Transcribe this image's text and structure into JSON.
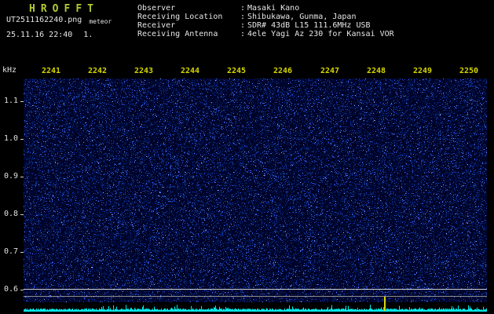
{
  "colors": {
    "background": "#000000",
    "logo": "#b4c832",
    "text": "#e6e6e6",
    "x_tick_label": "#d6d600",
    "y_tick_label": "#e0e0e0",
    "plot_bg": "#000328",
    "noise": [
      "#001a55",
      "#08309a",
      "#2a52d8",
      "#5578ff",
      "#90b0ff"
    ],
    "level_trace": "#00e8e8",
    "h_line_bright": "#d0d0d0",
    "h_line_dim": "#8f8f8f",
    "time_marker": "#d8d800"
  },
  "title": {
    "logo_letters": [
      "H",
      "R",
      "O",
      "F",
      "F",
      "T"
    ],
    "filename": "UT2511162240.png",
    "mode": "meteor",
    "datetime": "25.11.16 22:40",
    "page": "1."
  },
  "info": {
    "separator": ":",
    "rows": [
      {
        "label": "Observer",
        "value": "Masaki Kano"
      },
      {
        "label": "Receiving Location",
        "value": "Shibukawa, Gunma, Japan"
      },
      {
        "label": "Receiver",
        "value": "SDR# 43dB L15 111.6MHz USB"
      },
      {
        "label": "Receiving Antenna",
        "value": "4ele Yagi Az 230 for Kansai VOR"
      }
    ]
  },
  "spectrogram": {
    "y_axis_unit": "kHz",
    "y_ticks": [
      "1.1",
      "1.0",
      "0.9",
      "0.8",
      "0.7",
      "0.6"
    ],
    "x_ticks": [
      "2241",
      "2242",
      "2243",
      "2244",
      "2245",
      "2246",
      "2247",
      "2248",
      "2249",
      "2250"
    ]
  }
}
